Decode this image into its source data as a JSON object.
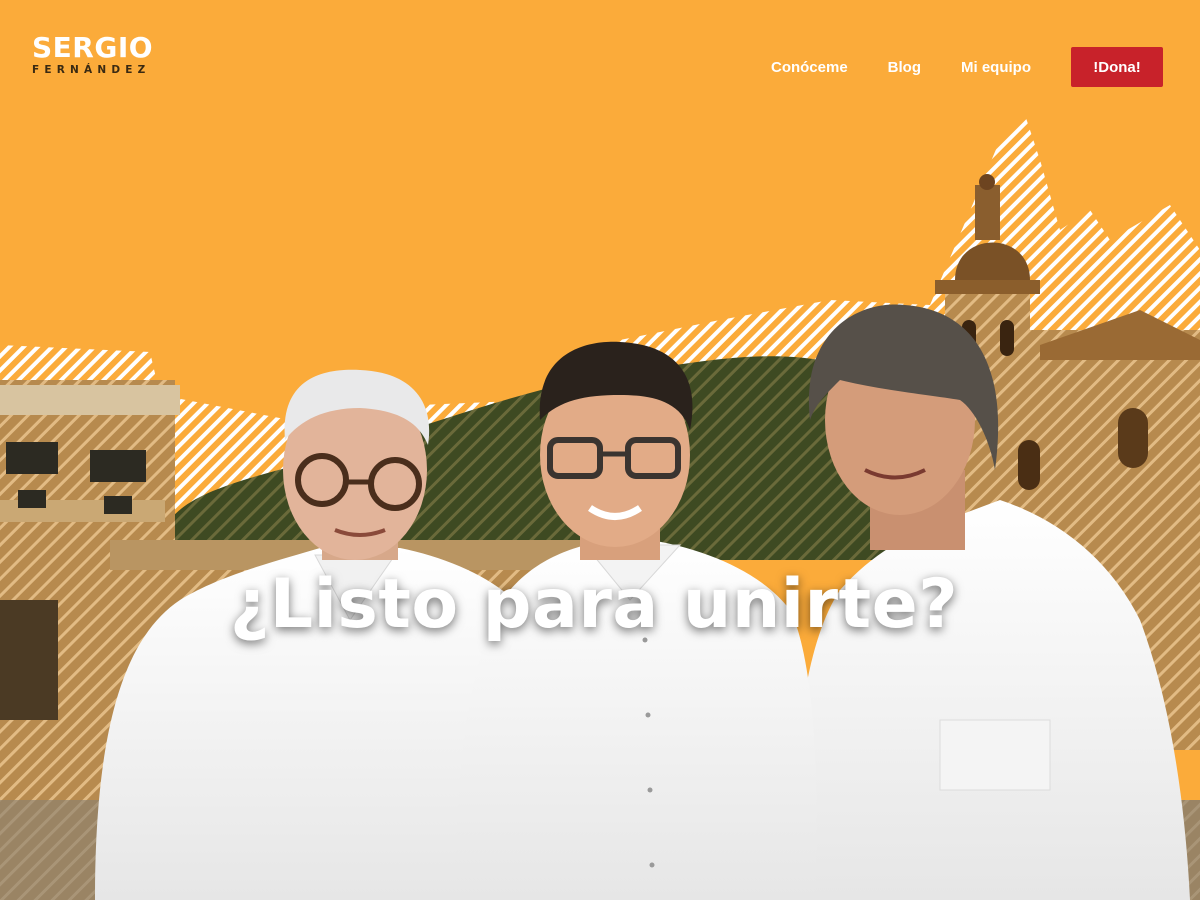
{
  "logo": {
    "first": "SERGIO",
    "last": "FERNÁNDEZ"
  },
  "nav": {
    "items": [
      "Conóceme",
      "Blog",
      "Mi equipo"
    ],
    "donate": "!Dona!"
  },
  "hero": {
    "title": "¿Listo para unirte?"
  },
  "colors": {
    "background": "#fbab3a",
    "donate": "#c8222a",
    "text": "#ffffff"
  }
}
